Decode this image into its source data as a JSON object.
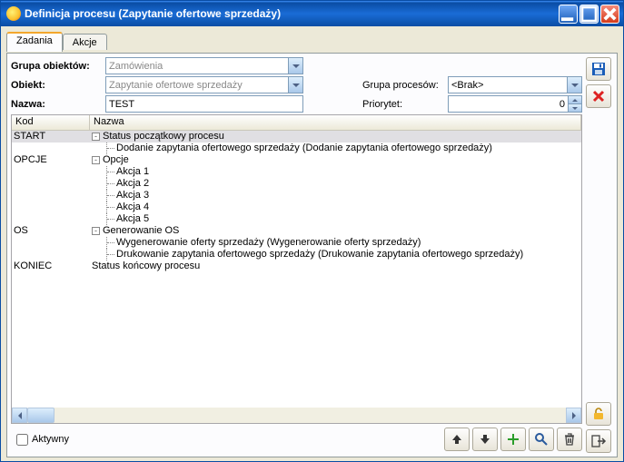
{
  "window": {
    "title": "Definicja procesu (Zapytanie ofertowe sprzedaży)"
  },
  "tabs": [
    {
      "label": "Zadania",
      "active": true
    },
    {
      "label": "Akcje",
      "active": false
    }
  ],
  "form": {
    "group_label": "Grupa obiektów:",
    "group_value": "Zamówienia",
    "object_label": "Obiekt:",
    "object_value": "Zapytanie ofertowe sprzedaży",
    "name_label": "Nazwa:",
    "name_value": "TEST",
    "procgroup_label": "Grupa procesów:",
    "procgroup_value": "<Brak>",
    "priority_label": "Priorytet:",
    "priority_value": "0"
  },
  "grid": {
    "headers": {
      "kod": "Kod",
      "nazwa": "Nazwa"
    },
    "kod_rows": [
      "START",
      "",
      "OPCJE",
      "",
      "",
      "",
      "",
      "",
      "OS",
      "",
      "",
      "KONIEC"
    ],
    "nazwa_rows": [
      {
        "indent": 0,
        "toggle": "-",
        "text": "Status początkowy procesu",
        "sel": true
      },
      {
        "indent": 1,
        "text": "Dodanie zapytania ofertowego sprzedaży (Dodanie zapytania ofertowego sprzedaży)"
      },
      {
        "indent": 0,
        "toggle": "-",
        "text": "Opcje"
      },
      {
        "indent": 1,
        "text": "Akcja 1"
      },
      {
        "indent": 1,
        "text": "Akcja 2"
      },
      {
        "indent": 1,
        "text": "Akcja 3"
      },
      {
        "indent": 1,
        "text": "Akcja 4"
      },
      {
        "indent": 1,
        "text": "Akcja 5"
      },
      {
        "indent": 0,
        "toggle": "-",
        "text": "Generowanie OS"
      },
      {
        "indent": 1,
        "text": "Wygenerowanie oferty sprzedaży (Wygenerowanie oferty sprzedaży)"
      },
      {
        "indent": 1,
        "text": "Drukowanie zapytania ofertowego sprzedaży (Drukowanie zapytania ofertowego sprzedaży)"
      },
      {
        "indent": 0,
        "text": "Status końcowy procesu"
      }
    ]
  },
  "footer": {
    "active_label": "Aktywny"
  }
}
